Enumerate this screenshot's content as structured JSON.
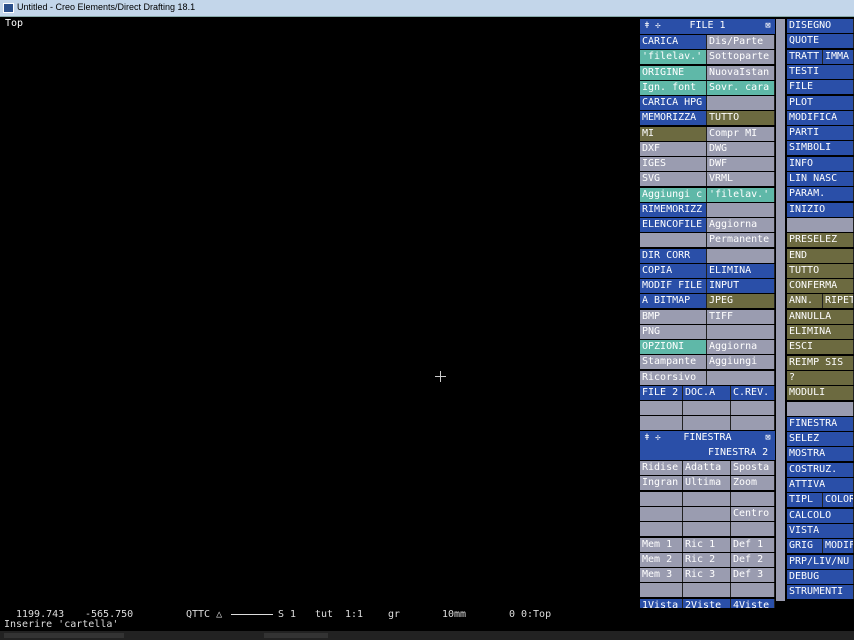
{
  "window": {
    "title": "Untitled - Creo Elements/Direct Drafting 18.1"
  },
  "viewport": {
    "label": "Top"
  },
  "colors": {
    "blue": "#2a4fa8",
    "gray": "#9a9cb0",
    "teal": "#5fb8a8",
    "olive": "#6c6a40",
    "dark": "#3a3a44"
  },
  "file_panel": {
    "header": "FILE 1",
    "rows": [
      [
        {
          "t": "CARICA",
          "c": "blue"
        },
        {
          "t": "Dis/Parte",
          "c": "gray"
        }
      ],
      [
        {
          "t": "'filelav.'",
          "c": "teal"
        },
        {
          "t": "Sottoparte",
          "c": "gray"
        }
      ],
      [
        {
          "t": "ORIGINE",
          "c": "teal"
        },
        {
          "t": "NuovaIstan",
          "c": "gray"
        }
      ],
      [
        {
          "t": "Ign. font",
          "c": "teal"
        },
        {
          "t": "Sovr. cara",
          "c": "teal"
        }
      ],
      [
        {
          "t": "CARICA HPG",
          "c": "blue"
        },
        {
          "t": "",
          "c": "gray"
        }
      ],
      [
        {
          "t": "MEMORIZZA",
          "c": "blue"
        },
        {
          "t": "TUTTO",
          "c": "olive"
        }
      ],
      [
        {
          "t": "MI",
          "c": "olive"
        },
        {
          "t": "Compr MI",
          "c": "gray"
        }
      ],
      [
        {
          "t": "DXF",
          "c": "gray"
        },
        {
          "t": "DWG",
          "c": "gray"
        }
      ],
      [
        {
          "t": "IGES",
          "c": "gray"
        },
        {
          "t": "DWF",
          "c": "gray"
        }
      ],
      [
        {
          "t": "SVG",
          "c": "gray"
        },
        {
          "t": "VRML",
          "c": "gray"
        }
      ],
      [
        {
          "t": "Aggiungi c",
          "c": "teal"
        },
        {
          "t": "'filelav.'",
          "c": "teal"
        }
      ],
      [
        {
          "t": "RIMEMORIZZ",
          "c": "blue"
        },
        {
          "t": "",
          "c": "gray"
        }
      ],
      [
        {
          "t": "ELENCOFILE",
          "c": "blue"
        },
        {
          "t": "Aggiorna",
          "c": "gray"
        }
      ],
      [
        {
          "t": "",
          "c": "gray"
        },
        {
          "t": "Permanente",
          "c": "gray"
        }
      ],
      [
        {
          "t": "DIR CORR",
          "c": "blue"
        },
        {
          "t": "",
          "c": "gray"
        }
      ],
      [
        {
          "t": "COPIA",
          "c": "blue"
        },
        {
          "t": "ELIMINA",
          "c": "blue"
        }
      ],
      [
        {
          "t": "MODIF FILE",
          "c": "blue"
        },
        {
          "t": "INPUT",
          "c": "blue"
        }
      ],
      [
        {
          "t": "A BITMAP",
          "c": "blue"
        },
        {
          "t": "JPEG",
          "c": "olive"
        }
      ],
      [
        {
          "t": "BMP",
          "c": "gray"
        },
        {
          "t": "TIFF",
          "c": "gray"
        }
      ],
      [
        {
          "t": "PNG",
          "c": "gray"
        },
        {
          "t": "",
          "c": "gray"
        }
      ],
      [
        {
          "t": "OPZIONI",
          "c": "teal"
        },
        {
          "t": "Aggiorna",
          "c": "gray"
        }
      ],
      [
        {
          "t": "Stampante",
          "c": "gray"
        },
        {
          "t": "Aggiungi",
          "c": "gray"
        }
      ],
      [
        {
          "t": "Ricorsivo",
          "c": "gray"
        },
        {
          "t": "",
          "c": "gray"
        }
      ]
    ],
    "bottom_row": [
      "FILE 2",
      "DOC.A",
      "C.REV."
    ]
  },
  "finestra_panel": {
    "header": "FINESTRA",
    "subheader": "FINESTRA 2",
    "rows": [
      [
        "Ridise",
        "Adatta",
        "Sposta"
      ],
      [
        "Ingran",
        "Ultima",
        "Zoom"
      ],
      [
        "",
        "",
        ""
      ],
      [
        "",
        "",
        "Centro"
      ],
      [
        "",
        "",
        ""
      ],
      [
        "Mem 1",
        "Ric 1",
        "Def 1"
      ],
      [
        "Mem 2",
        "Ric 2",
        "Def 2"
      ],
      [
        "Mem 3",
        "Ric 3",
        "Def 3"
      ],
      [
        "",
        "",
        ""
      ],
      [
        "1Vista",
        "2Viste",
        "4Viste"
      ]
    ]
  },
  "right_menu": {
    "items": [
      [
        {
          "t": "DISEGNO",
          "c": "blue"
        }
      ],
      [
        {
          "t": "QUOTE",
          "c": "blue"
        }
      ],
      [
        {
          "t": "TRATT",
          "c": "blue"
        },
        {
          "t": "IMMA",
          "c": "blue"
        }
      ],
      [
        {
          "t": "TESTI",
          "c": "blue"
        }
      ],
      [
        {
          "t": "FILE",
          "c": "blue"
        }
      ],
      [
        {
          "t": "PLOT",
          "c": "blue"
        }
      ],
      [
        {
          "t": "MODIFICA",
          "c": "blue"
        }
      ],
      [
        {
          "t": "PARTI",
          "c": "blue"
        }
      ],
      [
        {
          "t": "SIMBOLI",
          "c": "blue"
        }
      ],
      [
        {
          "t": "INFO",
          "c": "blue"
        }
      ],
      [
        {
          "t": "LIN NASC",
          "c": "blue"
        }
      ],
      [
        {
          "t": "PARAM.",
          "c": "blue"
        }
      ],
      [
        {
          "t": "INIZIO",
          "c": "blue"
        }
      ],
      [
        {
          "t": "",
          "c": "gray"
        }
      ],
      [
        {
          "t": "PRESELEZ",
          "c": "olive"
        }
      ],
      [
        {
          "t": "END",
          "c": "olive"
        }
      ],
      [
        {
          "t": "TUTTO",
          "c": "olive"
        }
      ],
      [
        {
          "t": "CONFERMA",
          "c": "olive"
        }
      ],
      [
        {
          "t": "ANN.",
          "c": "olive"
        },
        {
          "t": "RIPET",
          "c": "olive"
        }
      ],
      [
        {
          "t": "ANNULLA",
          "c": "olive"
        }
      ],
      [
        {
          "t": "ELIMINA",
          "c": "olive"
        }
      ],
      [
        {
          "t": "ESCI",
          "c": "olive"
        }
      ],
      [
        {
          "t": "REIMP SIS",
          "c": "olive"
        }
      ],
      [
        {
          "t": "?",
          "c": "olive"
        }
      ],
      [
        {
          "t": "MODULI",
          "c": "olive"
        }
      ],
      [
        {
          "t": "",
          "c": "gray"
        }
      ],
      [
        {
          "t": "FINESTRA",
          "c": "blue"
        }
      ],
      [
        {
          "t": "SELEZ",
          "c": "blue"
        }
      ],
      [
        {
          "t": "MOSTRA",
          "c": "blue"
        }
      ],
      [
        {
          "t": "COSTRUZ.",
          "c": "blue"
        }
      ],
      [
        {
          "t": "ATTIVA",
          "c": "blue"
        }
      ],
      [
        {
          "t": "TIPL",
          "c": "blue"
        },
        {
          "t": "COLOR",
          "c": "blue"
        }
      ],
      [
        {
          "t": "CALCOLO",
          "c": "blue"
        }
      ],
      [
        {
          "t": "VISTA",
          "c": "blue"
        }
      ],
      [
        {
          "t": "GRIG",
          "c": "blue"
        },
        {
          "t": "MODIF",
          "c": "blue"
        }
      ],
      [
        {
          "t": "PRP/LIV/NU",
          "c": "blue"
        }
      ],
      [
        {
          "t": "DEBUG",
          "c": "blue"
        }
      ],
      [
        {
          "t": "STRUMENTI",
          "c": "blue"
        }
      ]
    ]
  },
  "status": {
    "x": "1199.743",
    "y": "-565.750",
    "mode": "QTTC △",
    "s": "S 1",
    "tut": "tut",
    "scale": "1:1",
    "gr": "gr",
    "unit": "10mm",
    "zero": "0",
    "view": "0:Top",
    "prompt": "Inserire 'cartella'"
  }
}
